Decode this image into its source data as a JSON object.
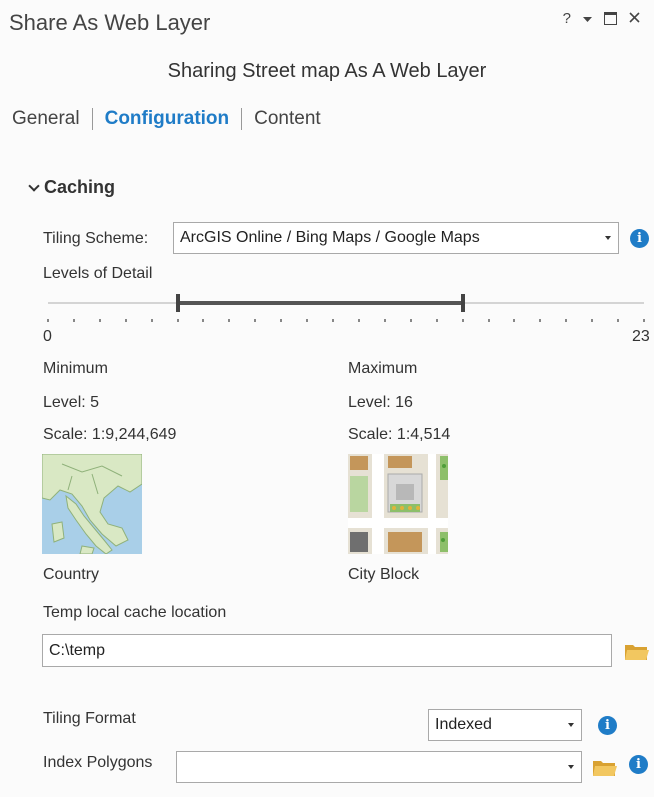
{
  "window": {
    "title": "Share As Web Layer",
    "help_label": "?"
  },
  "subtitle": "Sharing Street map As A Web Layer",
  "tabs": [
    {
      "label": "General"
    },
    {
      "label": "Configuration"
    },
    {
      "label": "Content"
    }
  ],
  "caching": {
    "section_label": "Caching",
    "tiling_scheme_label": "Tiling Scheme:",
    "tiling_scheme_value": "ArcGIS Online / Bing Maps / Google Maps",
    "levels_label": "Levels of Detail",
    "slider": {
      "min": 0,
      "max": 23,
      "min_label": "0",
      "max_label": "23",
      "selected_min": 5,
      "selected_max": 16
    },
    "minimum": {
      "heading": "Minimum",
      "level_label": "Level:",
      "level_value": "5",
      "scale_label": "Scale:",
      "scale_value": "1:9,244,649",
      "preview_caption": "Country"
    },
    "maximum": {
      "heading": "Maximum",
      "level_label": "Level:",
      "level_value": "16",
      "scale_label": "Scale:",
      "scale_value": "1:4,514",
      "preview_caption": "City Block"
    },
    "temp_cache_label": "Temp local cache location",
    "temp_cache_value": "C:\\temp",
    "tiling_format_label": "Tiling Format",
    "tiling_format_value": "Indexed",
    "index_polygons_label": "Index Polygons",
    "index_polygons_value": ""
  },
  "colors": {
    "accent": "#1f7cc7",
    "folder": "#e5b74a",
    "water": "#a9cfe8",
    "land": "#d9e8c4"
  }
}
